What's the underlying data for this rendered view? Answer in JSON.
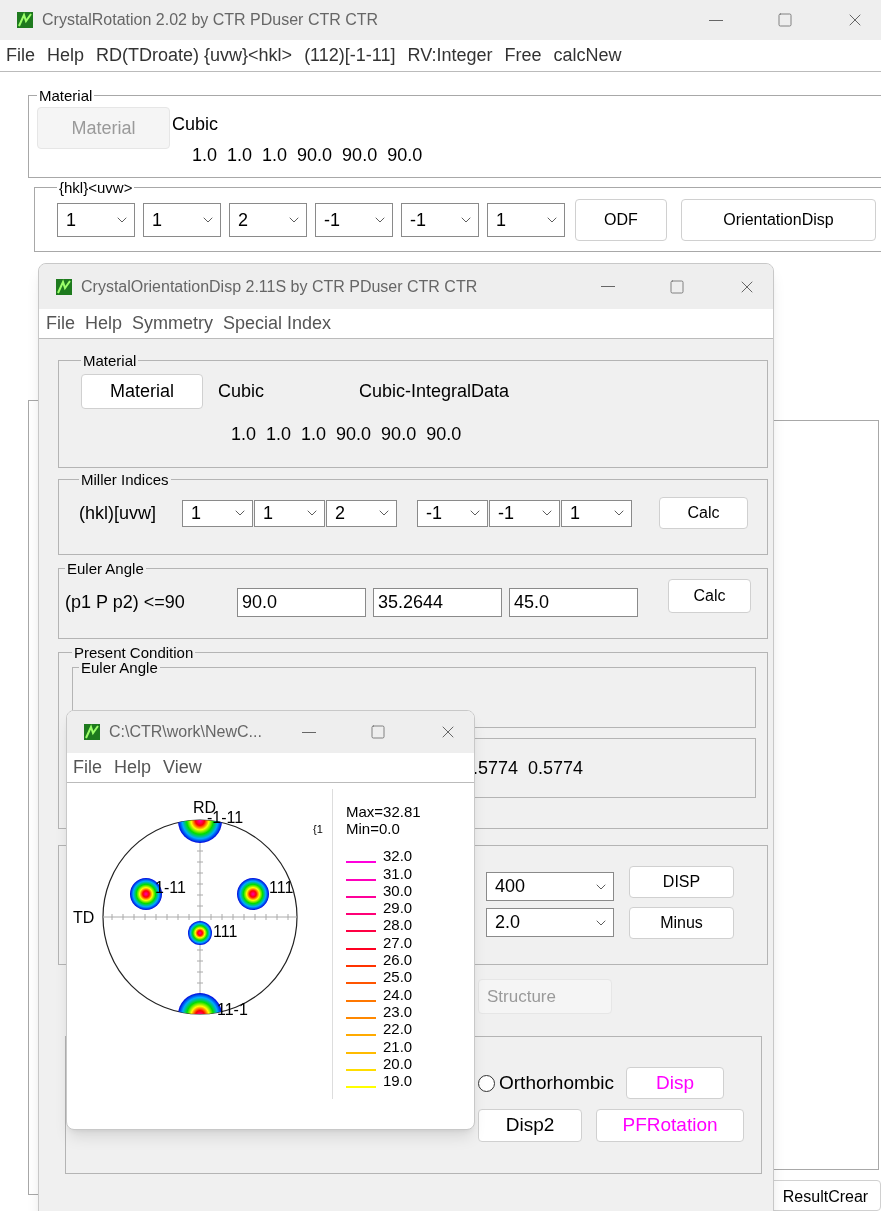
{
  "main_window": {
    "title": "CrystalRotation 2.02 by CTR PDuser CTR CTR",
    "menu": [
      "File",
      "Help",
      "RD(TDroate) {uvw}<hkl>",
      "(112)[-1-11]",
      "RV:Integer",
      "Free",
      "calcNew"
    ],
    "material_group": {
      "legend": "Material",
      "button": {
        "label": "Material",
        "disabled": true
      },
      "system": "Cubic",
      "lattice": "1.0  1.0  1.0  90.0  90.0  90.0"
    },
    "hkl_group": {
      "legend": "{hkl}<uvw>",
      "selects": [
        "1",
        "1",
        "2",
        "-1",
        "-1",
        "1"
      ],
      "buttons": [
        "ODF",
        "OrientationDisp"
      ]
    },
    "result_button": "ResultCrear"
  },
  "orientation_window": {
    "title": "CrystalOrientationDisp 2.11S by CTR PDuser CTR CTR",
    "menu": [
      "File",
      "Help",
      "Symmetry",
      "Special Index"
    ],
    "material_group": {
      "legend": "Material",
      "button": {
        "label": "Material",
        "disabled": false
      },
      "system": "Cubic",
      "data": "Cubic-IntegralData",
      "lattice": "1.0  1.0  1.0  90.0  90.0  90.0"
    },
    "miller_group": {
      "legend": "Miller Indices",
      "label": "(hkl)[uvw]",
      "hkl": [
        "1",
        "1",
        "2"
      ],
      "uvw": [
        "-1",
        "-1",
        "1"
      ],
      "button": "Calc"
    },
    "euler_group": {
      "legend": "Euler Angle",
      "label": "(p1 P p2) <=90",
      "values": [
        "90.0",
        "35.2644",
        "45.0"
      ],
      "button": "Calc"
    },
    "present_group": {
      "legend": "Present Condition",
      "inner_legend": "Euler Angle",
      "vector": ".5774  0.5774"
    },
    "display_group": {
      "selects": [
        "400",
        "2.0"
      ],
      "buttons": [
        "DISP",
        "Minus"
      ]
    },
    "structure_button": {
      "label": "Structure",
      "disabled": true
    },
    "symmetry_group": {
      "radio": {
        "label": "Orthorhombic",
        "selected": false
      },
      "buttons": [
        {
          "label": "Disp",
          "color": "#ff00ff"
        },
        {
          "label": "Disp2",
          "color": "#000000"
        },
        {
          "label": "PFRotation",
          "color": "#ff00ff"
        }
      ]
    }
  },
  "pole_figure_window": {
    "title": "C:\\CTR\\work\\NewC...",
    "menu": [
      "File",
      "Help",
      "View"
    ],
    "axis_labels": [
      "RD",
      "TD"
    ],
    "pole_labels": [
      "-1-11",
      "1-11",
      "111",
      "111",
      "11-1"
    ],
    "side_label": "{1",
    "max": "Max=32.81",
    "min": "Min=0.0",
    "legend": [
      {
        "label": "32.0",
        "color": "#ff00dd"
      },
      {
        "label": "31.0",
        "color": "#ff00bb"
      },
      {
        "label": "30.0",
        "color": "#ff0099"
      },
      {
        "label": "29.0",
        "color": "#ff0077"
      },
      {
        "label": "28.0",
        "color": "#ff0044"
      },
      {
        "label": "27.0",
        "color": "#ff0022"
      },
      {
        "label": "26.0",
        "color": "#ff3300"
      },
      {
        "label": "25.0",
        "color": "#ff5500"
      },
      {
        "label": "24.0",
        "color": "#ff7700"
      },
      {
        "label": "23.0",
        "color": "#ff8800"
      },
      {
        "label": "22.0",
        "color": "#ffaa00"
      },
      {
        "label": "21.0",
        "color": "#ffbb00"
      },
      {
        "label": "20.0",
        "color": "#ffdd00"
      },
      {
        "label": "19.0",
        "color": "#ffff00"
      }
    ]
  }
}
